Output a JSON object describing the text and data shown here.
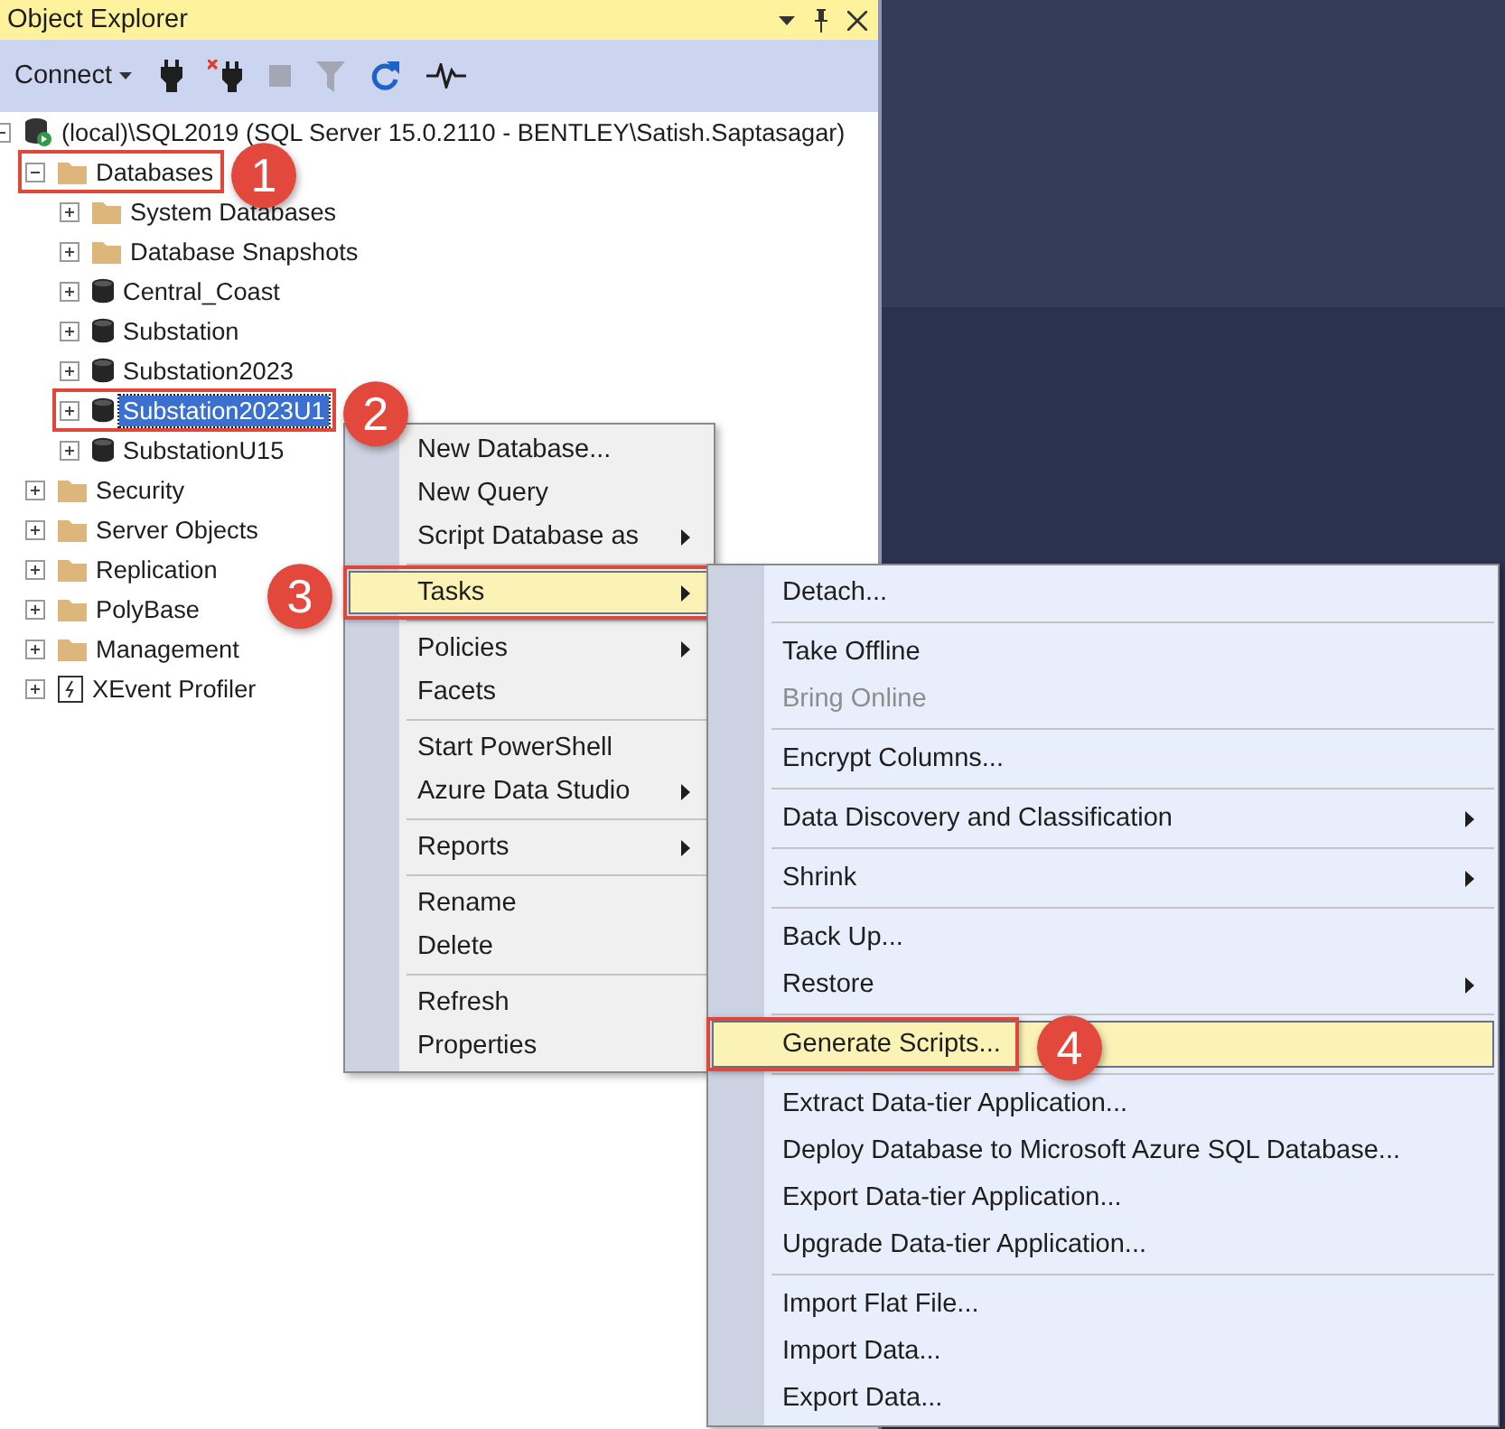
{
  "panel": {
    "title": "Object Explorer"
  },
  "toolbar": [
    {
      "kind": "connect",
      "label": "Connect",
      "disabled": false
    },
    {
      "kind": "plug",
      "disabled": false
    },
    {
      "kind": "unplug",
      "disabled": false
    },
    {
      "kind": "stop",
      "disabled": true
    },
    {
      "kind": "filter",
      "disabled": true
    },
    {
      "kind": "refresh",
      "disabled": false
    },
    {
      "kind": "activity",
      "disabled": false
    }
  ],
  "tree": [
    {
      "label": "(local)\\SQL2019 (SQL Server 15.0.2110 - BENTLEY\\Satish.Saptasagar)",
      "kind": "server",
      "expanded": true,
      "selected": false,
      "children": [
        {
          "label": "Databases",
          "kind": "folder",
          "expanded": true,
          "selected": false,
          "highlighted": true,
          "callout": "1",
          "children": [
            {
              "label": "System Databases",
              "kind": "folder",
              "expanded": false,
              "selected": false
            },
            {
              "label": "Database Snapshots",
              "kind": "folder",
              "expanded": false,
              "selected": false
            },
            {
              "label": "Central_Coast",
              "kind": "database",
              "expanded": false,
              "selected": false
            },
            {
              "label": "Substation",
              "kind": "database",
              "expanded": false,
              "selected": false
            },
            {
              "label": "Substation2023",
              "kind": "database",
              "expanded": false,
              "selected": false
            },
            {
              "label": "Substation2023U1",
              "kind": "database",
              "expanded": false,
              "selected": true,
              "highlighted": true,
              "callout": "2"
            },
            {
              "label": "SubstationU15",
              "kind": "database",
              "expanded": false,
              "selected": false
            }
          ]
        },
        {
          "label": "Security",
          "kind": "folder",
          "expanded": false,
          "selected": false
        },
        {
          "label": "Server Objects",
          "kind": "folder",
          "expanded": false,
          "selected": false
        },
        {
          "label": "Replication",
          "kind": "folder",
          "expanded": false,
          "selected": false
        },
        {
          "label": "PolyBase",
          "kind": "folder",
          "expanded": false,
          "selected": false
        },
        {
          "label": "Management",
          "kind": "folder",
          "expanded": false,
          "selected": false
        },
        {
          "label": "XEvent Profiler",
          "kind": "profiler",
          "expanded": false,
          "selected": false
        }
      ]
    }
  ],
  "context_menu": {
    "items": [
      {
        "kind": "item",
        "label": "New Database...",
        "submenu": false,
        "selected": false
      },
      {
        "kind": "item",
        "label": "New Query",
        "submenu": false,
        "selected": false
      },
      {
        "kind": "item",
        "label": "Script Database as",
        "submenu": true,
        "selected": false
      },
      {
        "kind": "separator"
      },
      {
        "kind": "item",
        "label": "Tasks",
        "submenu": true,
        "selected": true,
        "highlighted": true,
        "callout": "3"
      },
      {
        "kind": "separator"
      },
      {
        "kind": "item",
        "label": "Policies",
        "submenu": true,
        "selected": false
      },
      {
        "kind": "item",
        "label": "Facets",
        "submenu": false,
        "selected": false
      },
      {
        "kind": "separator"
      },
      {
        "kind": "item",
        "label": "Start PowerShell",
        "submenu": false,
        "selected": false
      },
      {
        "kind": "item",
        "label": "Azure Data Studio",
        "submenu": true,
        "selected": false
      },
      {
        "kind": "separator"
      },
      {
        "kind": "item",
        "label": "Reports",
        "submenu": true,
        "selected": false
      },
      {
        "kind": "separator"
      },
      {
        "kind": "item",
        "label": "Rename",
        "submenu": false,
        "selected": false
      },
      {
        "kind": "item",
        "label": "Delete",
        "submenu": false,
        "selected": false
      },
      {
        "kind": "separator"
      },
      {
        "kind": "item",
        "label": "Refresh",
        "submenu": false,
        "selected": false
      },
      {
        "kind": "item",
        "label": "Properties",
        "submenu": false,
        "selected": false
      }
    ]
  },
  "tasks_submenu": {
    "items": [
      {
        "kind": "item",
        "label": "Detach...",
        "submenu": false,
        "selected": false,
        "disabled": false
      },
      {
        "kind": "separator"
      },
      {
        "kind": "item",
        "label": "Take Offline",
        "submenu": false,
        "selected": false,
        "disabled": false
      },
      {
        "kind": "item",
        "label": "Bring Online",
        "submenu": false,
        "selected": false,
        "disabled": true
      },
      {
        "kind": "separator"
      },
      {
        "kind": "item",
        "label": "Encrypt Columns...",
        "submenu": false,
        "selected": false,
        "disabled": false
      },
      {
        "kind": "separator"
      },
      {
        "kind": "item",
        "label": "Data Discovery and Classification",
        "submenu": true,
        "selected": false,
        "disabled": false
      },
      {
        "kind": "separator"
      },
      {
        "kind": "item",
        "label": "Shrink",
        "submenu": true,
        "selected": false,
        "disabled": false
      },
      {
        "kind": "separator"
      },
      {
        "kind": "item",
        "label": "Back Up...",
        "submenu": false,
        "selected": false,
        "disabled": false
      },
      {
        "kind": "item",
        "label": "Restore",
        "submenu": true,
        "selected": false,
        "disabled": false
      },
      {
        "kind": "separator"
      },
      {
        "kind": "item",
        "label": "Generate Scripts...",
        "submenu": false,
        "selected": true,
        "disabled": false,
        "highlighted": true,
        "callout": "4"
      },
      {
        "kind": "separator"
      },
      {
        "kind": "item",
        "label": "Extract Data-tier Application...",
        "submenu": false,
        "selected": false,
        "disabled": false
      },
      {
        "kind": "item",
        "label": "Deploy Database to Microsoft Azure SQL Database...",
        "submenu": false,
        "selected": false,
        "disabled": false
      },
      {
        "kind": "item",
        "label": "Export Data-tier Application...",
        "submenu": false,
        "selected": false,
        "disabled": false
      },
      {
        "kind": "item",
        "label": "Upgrade Data-tier Application...",
        "submenu": false,
        "selected": false,
        "disabled": false
      },
      {
        "kind": "separator"
      },
      {
        "kind": "item",
        "label": "Import Flat File...",
        "submenu": false,
        "selected": false,
        "disabled": false
      },
      {
        "kind": "item",
        "label": "Import Data...",
        "submenu": false,
        "selected": false,
        "disabled": false
      },
      {
        "kind": "item",
        "label": "Export Data...",
        "submenu": false,
        "selected": false,
        "disabled": false
      }
    ]
  }
}
